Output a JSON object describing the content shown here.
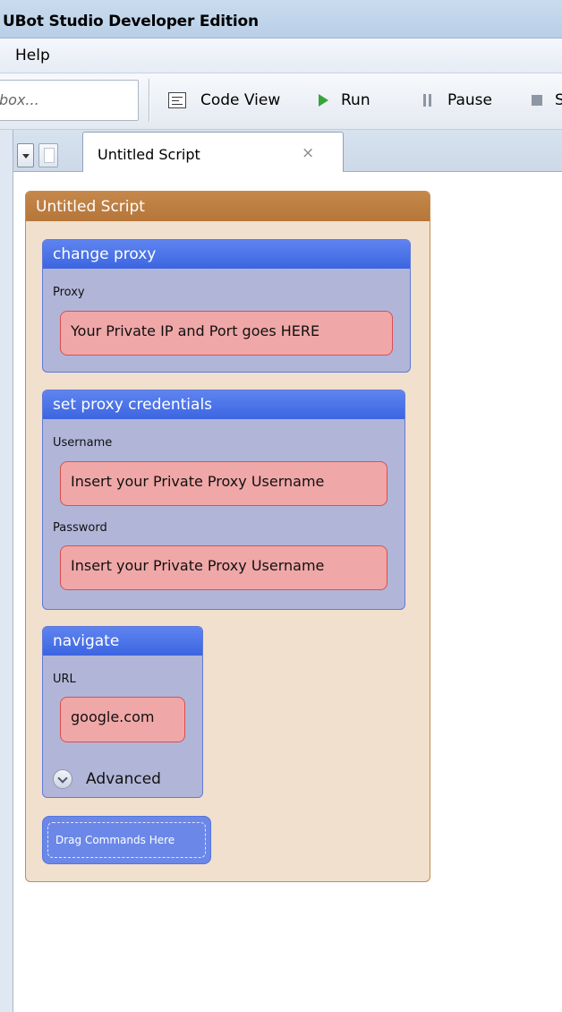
{
  "window": {
    "title": "UBot Studio Developer Edition"
  },
  "menu": {
    "items": [
      "Help"
    ]
  },
  "toolbar": {
    "search_text": "box...",
    "code_view_label": "Code View",
    "run_label": "Run",
    "pause_label": "Pause",
    "stop_label": "S"
  },
  "tabs": {
    "active_label": "Untitled Script",
    "close_glyph": "×"
  },
  "script": {
    "title": "Untitled Script",
    "commands": [
      {
        "title": "change proxy",
        "params": [
          {
            "label": "Proxy",
            "value": "Your Private  IP and Port goes HERE"
          }
        ]
      },
      {
        "title": "set proxy credentials",
        "params": [
          {
            "label": "Username",
            "value": "Insert your Private Proxy Username"
          },
          {
            "label": "Password",
            "value": "Insert your Private Proxy Username"
          }
        ]
      },
      {
        "title": "navigate",
        "params": [
          {
            "label": "URL",
            "value": "google.com"
          }
        ],
        "advanced_label": "Advanced"
      }
    ],
    "drag_placeholder": "Drag Commands Here"
  },
  "colors": {
    "script_header": "#b97a3f",
    "script_body": "#f0e0cd",
    "command_header": "#4a70e8",
    "command_body": "#b1b6d8",
    "param_fill": "#f0a7a7",
    "param_border": "#d94f52",
    "run_icon": "#37a33a"
  },
  "icons": {
    "code_view": "code-view-icon",
    "run": "play-icon",
    "pause": "pause-icon",
    "stop": "stop-icon",
    "tab_dropdown": "chevron-down-icon",
    "new_tab": "document-icon",
    "advanced": "expand-circle-icon"
  }
}
